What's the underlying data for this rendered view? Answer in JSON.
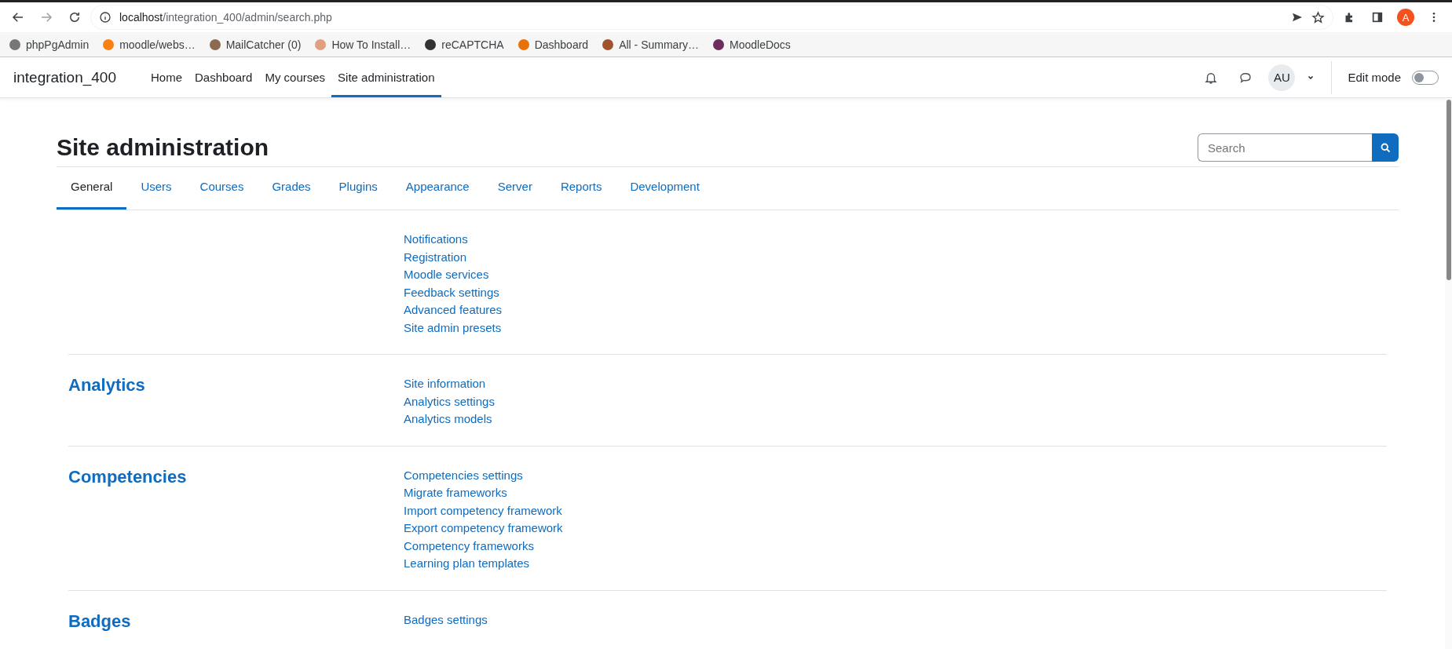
{
  "browser": {
    "url_host": "localhost",
    "url_path": "/integration_400/admin/search.php",
    "profile_initial": "A",
    "bookmarks": [
      {
        "label": "phpPgAdmin",
        "color": "#777777"
      },
      {
        "label": "moodle/webs…",
        "color": "#f98012"
      },
      {
        "label": "MailCatcher (0)",
        "color": "#8a6a50"
      },
      {
        "label": "How To Install…",
        "color": "#e0a080"
      },
      {
        "label": "reCAPTCHA",
        "color": "#333333"
      },
      {
        "label": "Dashboard",
        "color": "#e8710a"
      },
      {
        "label": "All - Summary…",
        "color": "#a0522d"
      },
      {
        "label": "MoodleDocs",
        "color": "#6d2e5e"
      }
    ]
  },
  "navbar": {
    "brand": "integration_400",
    "items": [
      {
        "label": "Home",
        "selected": false
      },
      {
        "label": "Dashboard",
        "selected": false
      },
      {
        "label": "My courses",
        "selected": false
      },
      {
        "label": "Site administration",
        "selected": true
      }
    ],
    "avatar": "AU",
    "edit_mode": {
      "label": "Edit mode",
      "on": false
    }
  },
  "page": {
    "title": "Site administration",
    "search_placeholder": "Search",
    "tabs": [
      {
        "label": "General",
        "selected": true
      },
      {
        "label": "Users",
        "selected": false
      },
      {
        "label": "Courses",
        "selected": false
      },
      {
        "label": "Grades",
        "selected": false
      },
      {
        "label": "Plugins",
        "selected": false
      },
      {
        "label": "Appearance",
        "selected": false
      },
      {
        "label": "Server",
        "selected": false
      },
      {
        "label": "Reports",
        "selected": false
      },
      {
        "label": "Development",
        "selected": false
      }
    ],
    "sections": [
      {
        "links": [
          "Notifications",
          "Registration",
          "Moodle services",
          "Feedback settings",
          "Advanced features",
          "Site admin presets"
        ]
      },
      {
        "heading": "Analytics",
        "links": [
          "Site information",
          "Analytics settings",
          "Analytics models"
        ]
      },
      {
        "heading": "Competencies",
        "links": [
          "Competencies settings",
          "Migrate frameworks",
          "Import competency framework",
          "Export competency framework",
          "Competency frameworks",
          "Learning plan templates"
        ]
      },
      {
        "heading": "Badges",
        "links": [
          "Badges settings"
        ]
      }
    ]
  }
}
